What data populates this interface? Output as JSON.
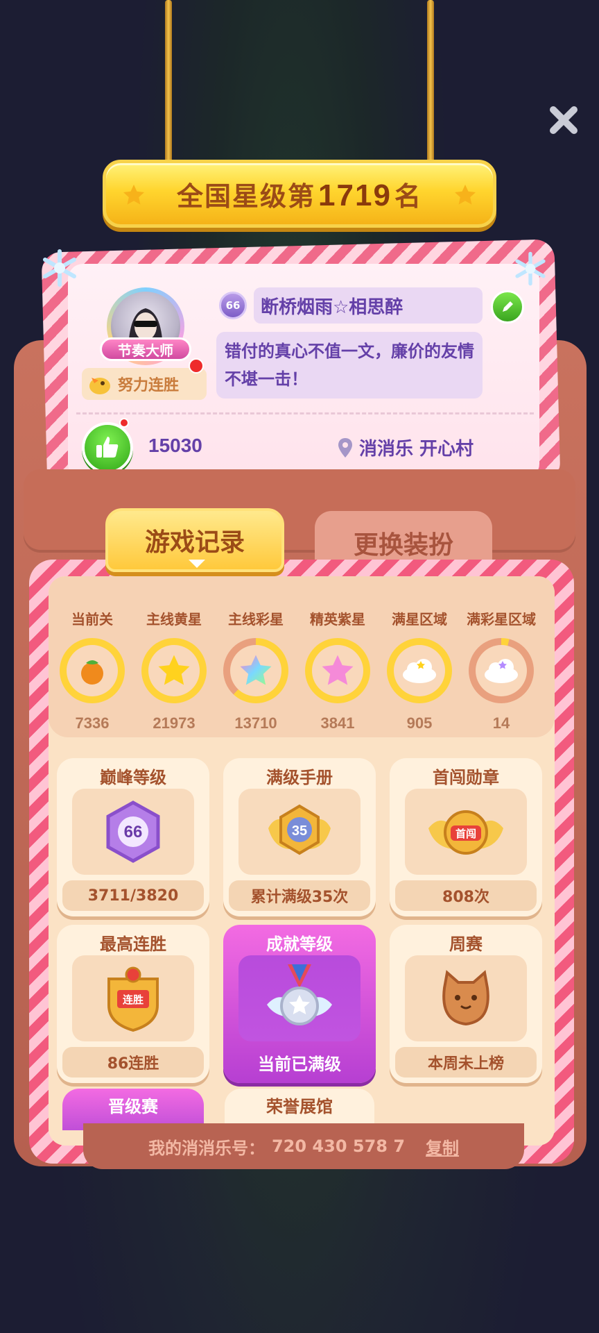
{
  "rank": {
    "prefix": "全国星级第",
    "number": "1719",
    "suffix": "名"
  },
  "profile": {
    "title_badge": "节奏大师",
    "effort_label": "努力连胜",
    "level": "66",
    "nickname": "断桥烟雨☆相思醉",
    "motto": "错付的真心不值一文，廉价的友情不堪一击！",
    "likes": "15030",
    "location": "消消乐  开心村"
  },
  "tabs": [
    {
      "label": "游戏记录",
      "active": true
    },
    {
      "label": "更换装扮",
      "active": false
    }
  ],
  "stats": [
    {
      "label": "当前关",
      "value": "7336",
      "icon": "persimmon-icon"
    },
    {
      "label": "主线黄星",
      "value": "21973",
      "icon": "yellow-star-icon"
    },
    {
      "label": "主线彩星",
      "value": "13710",
      "icon": "rainbow-star-icon"
    },
    {
      "label": "精英紫星",
      "value": "3841",
      "icon": "pink-star-icon"
    },
    {
      "label": "满星区域",
      "value": "905",
      "icon": "cloud-icon"
    },
    {
      "label": "满彩星区域",
      "value": "14",
      "icon": "rainbow-cloud-icon"
    }
  ],
  "tiles": [
    {
      "title": "巅峰等级",
      "foot": "3711/3820",
      "icon_text": "66"
    },
    {
      "title": "满级手册",
      "foot": "累计满级35次",
      "icon_text": "35"
    },
    {
      "title": "首闯勋章",
      "foot": "808次",
      "icon_text": "首闯"
    },
    {
      "title": "最高连胜",
      "foot": "86连胜",
      "icon_text": "连胜"
    },
    {
      "title": "成就等级",
      "foot": "当前已满级"
    },
    {
      "title": "周赛",
      "foot": "本周未上榜"
    }
  ],
  "peek_tiles": [
    "晋级赛",
    "荣誉展馆"
  ],
  "footer": {
    "label": "我的消消乐号：",
    "id": "720 430 578 7",
    "copy": "复制"
  },
  "colors": {
    "accent_gold": "#ffd52e",
    "brand_pink": "#f25a7e",
    "text_purple": "#6440a8",
    "text_brown": "#a4522d"
  }
}
